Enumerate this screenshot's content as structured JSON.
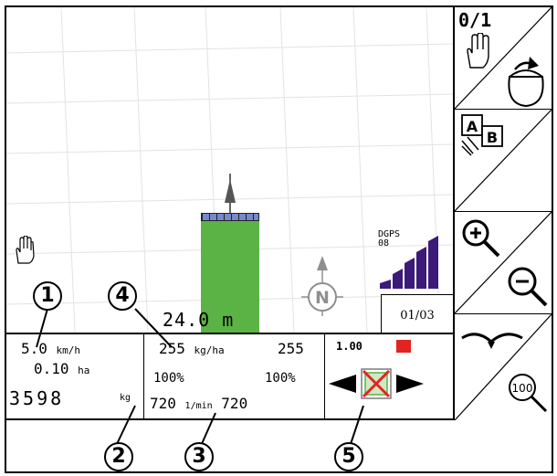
{
  "map": {
    "track_distance": "24.0 m",
    "gps_label_top": "DGPS",
    "gps_label_bottom": "08",
    "page_indicator": "01/03"
  },
  "status": {
    "speed_value": "5.0",
    "speed_unit": "km/h",
    "area_value": "0.10",
    "area_unit": "ha",
    "weight_value": "3598",
    "weight_unit": "kg",
    "rate_actual": "255",
    "rate_unit": "kg/ha",
    "rate_target": "255",
    "percent_left": "100%",
    "percent_right": "100%",
    "rpm_left": "720",
    "rpm_unit": "1/min",
    "rpm_right": "720",
    "width_factor": "1.00"
  },
  "softkeys": {
    "manual_mode_label": "0/1"
  },
  "callouts": [
    "1",
    "2",
    "3",
    "4",
    "5"
  ],
  "colors": {
    "spread_track": "#5bb345",
    "boom_bar": "#7788cc",
    "signal_bars": "#3c1a78",
    "status_red": "#e32222",
    "compass": "#8f8f8f",
    "grid_lines": "#e3e3e3"
  }
}
